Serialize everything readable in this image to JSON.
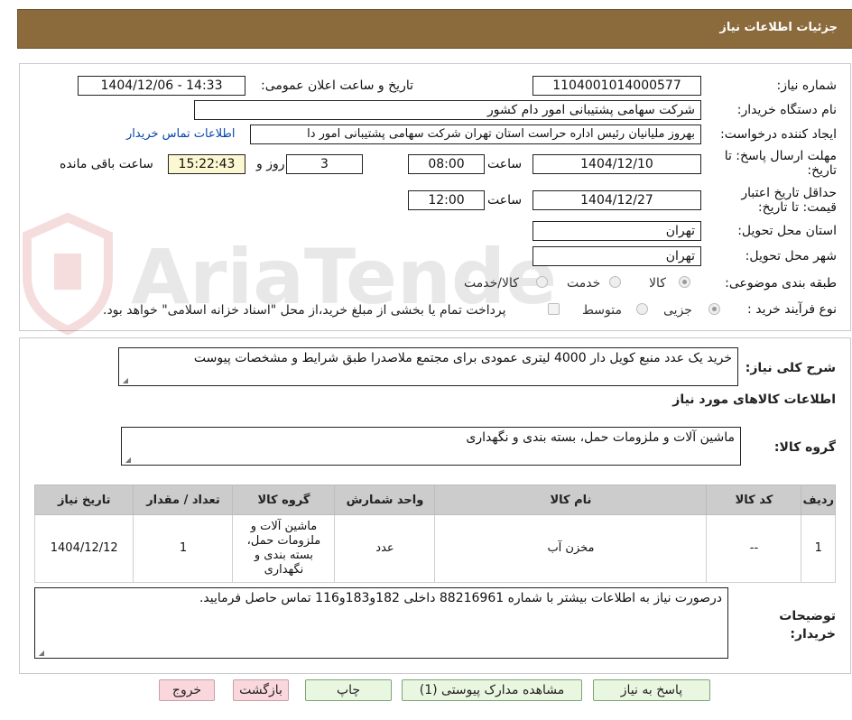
{
  "header": {
    "title": "جزئیات اطلاعات نیاز"
  },
  "form": {
    "need_number_label": "شماره نیاز:",
    "need_number": "1104001014000577",
    "announce_label": "تاریخ و ساعت اعلان عمومی:",
    "announce_value": "1404/12/06 - 14:33",
    "buyer_label": "نام دستگاه خریدار:",
    "buyer_value": "شرکت سهامی پشتیبانی امور دام کشور",
    "creator_label": "ایجاد کننده درخواست:",
    "creator_value": "بهروز ملیانیان رئیس اداره حراست استان تهران شرکت سهامی پشتیبانی امور دا",
    "contact_link": "اطلاعات تماس خریدار",
    "deadline_label": "مهلت ارسال پاسخ: تا تاریخ:",
    "deadline_date": "1404/12/10",
    "time_label": "ساعت",
    "deadline_time": "08:00",
    "days_value": "3",
    "days_label": "روز و",
    "remaining_time": "15:22:43",
    "remaining_label": "ساعت باقی مانده",
    "validity_label": "حداقل تاریخ اعتبار قیمت: تا تاریخ:",
    "validity_date": "1404/12/27",
    "validity_time": "12:00",
    "province_label": "استان محل تحویل:",
    "province_value": "تهران",
    "city_label": "شهر محل تحویل:",
    "city_value": "تهران",
    "category_label": "طبقه بندی موضوعی:",
    "category_options": [
      "کالا",
      "خدمت",
      "کالا/خدمت"
    ],
    "process_label": "نوع فرآیند خرید :",
    "process_options": [
      "جزیی",
      "متوسط"
    ],
    "payment_note": "پرداخت تمام یا بخشی از مبلغ خرید،از محل \"اسناد خزانه اسلامی\" خواهد بود."
  },
  "watermark_text": "AriaTender.neT",
  "details": {
    "summary_label": "شرح کلی نیاز:",
    "summary_value": "خرید یک عدد منبع کویل دار 4000 لیتری عمودی برای مجتمع ملاصدرا طبق شرایط و مشخصات پیوست",
    "goods_info_title": "اطلاعات کالاهای مورد نیاز",
    "goods_group_label": "گروه کالا:",
    "goods_group_value": "ماشین آلات و ملزومات حمل، بسته بندی و نگهداری",
    "table_headers": [
      "ردیف",
      "کد کالا",
      "نام کالا",
      "واحد شمارش",
      "گروه کالا",
      "تعداد / مقدار",
      "تاریخ نیاز"
    ],
    "rows": [
      [
        "1",
        "--",
        "مخزن آب",
        "عدد",
        "ماشین آلات و ملزومات حمل، بسته بندی و نگهداری",
        "1",
        "1404/12/12"
      ]
    ],
    "buyer_notes_label": "توضیحات خریدار:",
    "buyer_notes_value": "درصورت نیاز به اطلاعات بیشتر با شماره 88216961 داخلی 182و183و116 تماس حاصل فرمایید."
  },
  "buttons": {
    "reply": "پاسخ به نیاز",
    "attachments": "مشاهده مدارک پیوستی (1)",
    "print": "چاپ",
    "back": "بازگشت",
    "exit": "خروج"
  }
}
